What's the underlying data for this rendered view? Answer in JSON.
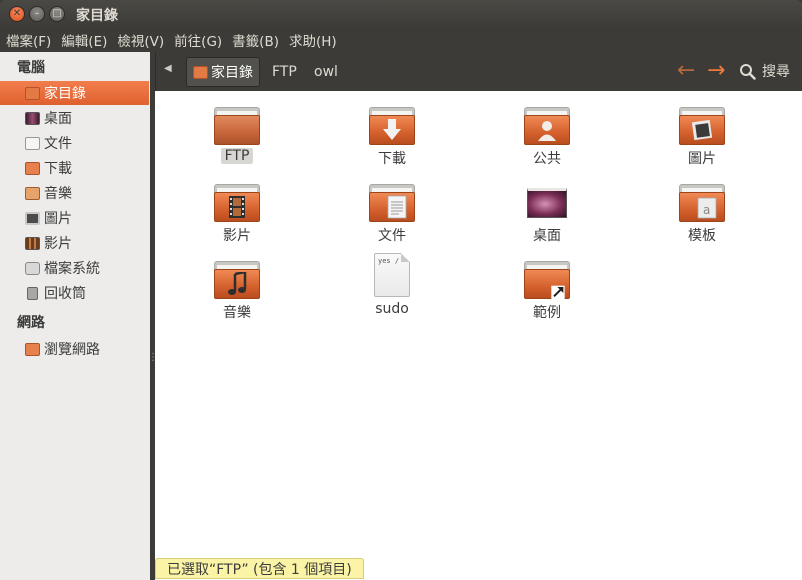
{
  "window": {
    "title": "家目錄",
    "close_glyph": "✕",
    "minimize_glyph": "–",
    "maximize_glyph": "□"
  },
  "menu": [
    "檔案(F)",
    "編輯(E)",
    "檢視(V)",
    "前往(G)",
    "書籤(B)",
    "求助(H)"
  ],
  "sidebar": {
    "heading_computer": "電腦",
    "heading_network": "網路",
    "items": [
      {
        "label": "家目錄",
        "icon": "home-folder-icon",
        "selected": true
      },
      {
        "label": "桌面",
        "icon": "desktop-icon"
      },
      {
        "label": "文件",
        "icon": "documents-icon"
      },
      {
        "label": "下載",
        "icon": "downloads-icon"
      },
      {
        "label": "音樂",
        "icon": "music-icon"
      },
      {
        "label": "圖片",
        "icon": "pictures-icon"
      },
      {
        "label": "影片",
        "icon": "videos-icon"
      },
      {
        "label": "檔案系統",
        "icon": "filesystem-icon"
      },
      {
        "label": "回收筒",
        "icon": "trash-icon"
      }
    ],
    "network_items": [
      {
        "label": "瀏覽網路",
        "icon": "network-icon"
      }
    ]
  },
  "location": {
    "crumbs": [
      "家目錄",
      "FTP",
      "owl"
    ],
    "search_label": "搜尋"
  },
  "files": [
    {
      "name": "FTP",
      "type": "folder",
      "selected": true
    },
    {
      "name": "下載",
      "type": "folder",
      "emblem": "download-arrow-icon"
    },
    {
      "name": "公共",
      "type": "folder",
      "emblem": "person-icon"
    },
    {
      "name": "圖片",
      "type": "folder",
      "emblem": "picture-icon"
    },
    {
      "name": "影片",
      "type": "folder",
      "emblem": "film-icon"
    },
    {
      "name": "文件",
      "type": "folder",
      "emblem": "document-icon"
    },
    {
      "name": "桌面",
      "type": "desktop"
    },
    {
      "name": "模板",
      "type": "folder",
      "emblem": "template-icon"
    },
    {
      "name": "音樂",
      "type": "folder",
      "emblem": "music-note-icon"
    },
    {
      "name": "sudo",
      "type": "text-file",
      "preview": "yes  /"
    },
    {
      "name": "範例",
      "type": "folder",
      "emblem": "link-arrow-icon"
    }
  ],
  "status": "已選取“FTP” (包含 1 個項目)",
  "colors": {
    "accent": "#e0602f",
    "titlebar": "#3c3b37",
    "sidebar_bg": "#edecea",
    "status_bg": "#fbf4a7"
  }
}
